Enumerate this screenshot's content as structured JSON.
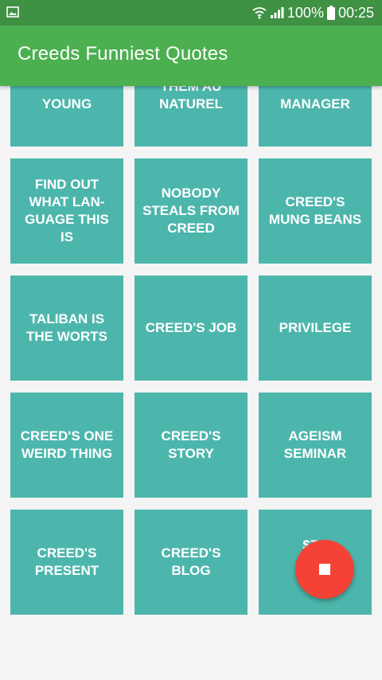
{
  "status_bar": {
    "battery": "100%",
    "time": "00:25"
  },
  "app_bar": {
    "title": "Creeds Funniest Quotes"
  },
  "tiles": [
    "YOUNG",
    "THEM AU NATUREL",
    "MANAGER",
    "FIND OUT WHAT LAN-GUAGE THIS IS",
    "NOBODY STEALS FROM CREED",
    "CREED'S MUNG BEANS",
    "TALIBAN IS THE WORTS",
    "CREED'S JOB",
    "PRIVILEGE",
    "CREED'S ONE WEIRD THING",
    "CREED'S STORY",
    "AGEISM SEMINAR",
    "CREED'S PRESENT",
    "CREED'S BLOG",
    "$7K"
  ],
  "colors": {
    "status_bar": "#3f9143",
    "app_bar": "#4caf50",
    "tile": "#4db6ac",
    "fab": "#f44336"
  },
  "icons": {
    "status_left": "image-icon",
    "wifi": "wifi-icon",
    "signal": "signal-icon",
    "battery": "battery-icon",
    "fab": "stop-icon"
  }
}
